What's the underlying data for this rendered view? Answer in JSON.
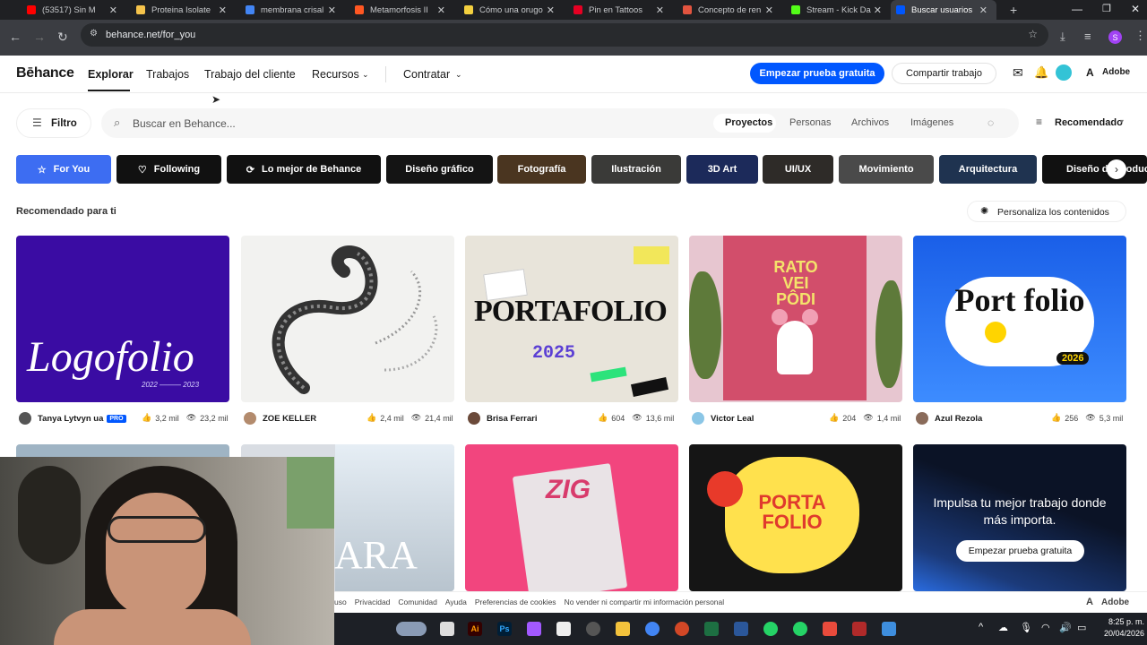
{
  "browser": {
    "tabs": [
      {
        "title": "(53517) Sin M",
        "color": "#ff0000"
      },
      {
        "title": "Proteina Isolate",
        "color": "#f5c34b"
      },
      {
        "title": "membrana crisal",
        "color": "#4285f4"
      },
      {
        "title": "Metamorfosis II",
        "color": "#ff5722"
      },
      {
        "title": "Cómo una orugo",
        "color": "#f4d03f"
      },
      {
        "title": "Pin en Tattoos",
        "color": "#e60023"
      },
      {
        "title": "Concepto de ren",
        "color": "#e2543f"
      },
      {
        "title": "Stream - Kick Da",
        "color": "#53fc18"
      },
      {
        "title": "Buscar usuarios",
        "color": "#0057ff"
      }
    ],
    "url": "behance.net/for_you",
    "profile_initial": "S"
  },
  "header": {
    "logo": "Bēhance",
    "nav": [
      "Explorar",
      "Trabajos",
      "Trabajo del cliente",
      "Recursos",
      "Contratar"
    ],
    "cta_trial": "Empezar prueba gratuita",
    "cta_share": "Compartir trabajo",
    "adobe": "Adobe"
  },
  "search": {
    "filter_label": "Filtro",
    "placeholder": "Buscar en Behance...",
    "scopes": [
      "Proyectos",
      "Personas",
      "Archivos",
      "Imágenes"
    ],
    "sort_label": "Recomendado"
  },
  "categories": [
    {
      "label": "For You",
      "bg": "#3d6df2"
    },
    {
      "label": "Following",
      "bg": "#111111"
    },
    {
      "label": "Lo mejor de Behance",
      "bg": "#111111"
    },
    {
      "label": "Diseño gráfico",
      "bg": "#141414"
    },
    {
      "label": "Fotografía",
      "bg": "#4a3520"
    },
    {
      "label": "Ilustración",
      "bg": "#3a3a38"
    },
    {
      "label": "3D Art",
      "bg": "#1c2a5a"
    },
    {
      "label": "UI/UX",
      "bg": "#2e2b28"
    },
    {
      "label": "Movimiento",
      "bg": "#4a4a4a"
    },
    {
      "label": "Arquitectura",
      "bg": "#1f3350"
    },
    {
      "label": "Diseño de produc",
      "bg": "#111111"
    }
  ],
  "section": {
    "title": "Recomendado para ti",
    "personalize": "Personaliza los contenidos"
  },
  "projects": [
    {
      "cover_text": "Logofolio",
      "cover_sub": "2022 ——— 2023",
      "author": "Tanya Lytvyn ua",
      "pro": "PRO",
      "likes": "3,2 mil",
      "views": "23,2 mil"
    },
    {
      "cover_text": "",
      "author": "ZOE KELLER",
      "likes": "2,4 mil",
      "views": "21,4 mil"
    },
    {
      "cover_text": "PORTAFOLIO",
      "cover_sub": "2025",
      "author": "Brisa Ferrari",
      "likes": "604",
      "views": "13,6 mil"
    },
    {
      "cover_text": "RATO VEI PÔDI",
      "author": "Victor Leal",
      "likes": "204",
      "views": "1,4 mil"
    },
    {
      "cover_text": "Port folio",
      "cover_sub": "2026",
      "author": "Azul Rezola",
      "likes": "256",
      "views": "5,3 mil"
    }
  ],
  "row2": {
    "card3_text": "ZIG",
    "card4_text": "PORTA FOLIO",
    "promo_text": "Impulsa tu mejor trabajo donde más importa.",
    "promo_button": "Empezar prueba gratuita",
    "card2_text": "ARA"
  },
  "footer": {
    "links": [
      "uso",
      "Privacidad",
      "Comunidad",
      "Ayuda",
      "Preferencias de cookies",
      "No vender ni compartir mi información personal"
    ],
    "adobe": "Adobe"
  },
  "taskbar": {
    "time": "8:25 p. m.",
    "date": "20/04/2026"
  }
}
